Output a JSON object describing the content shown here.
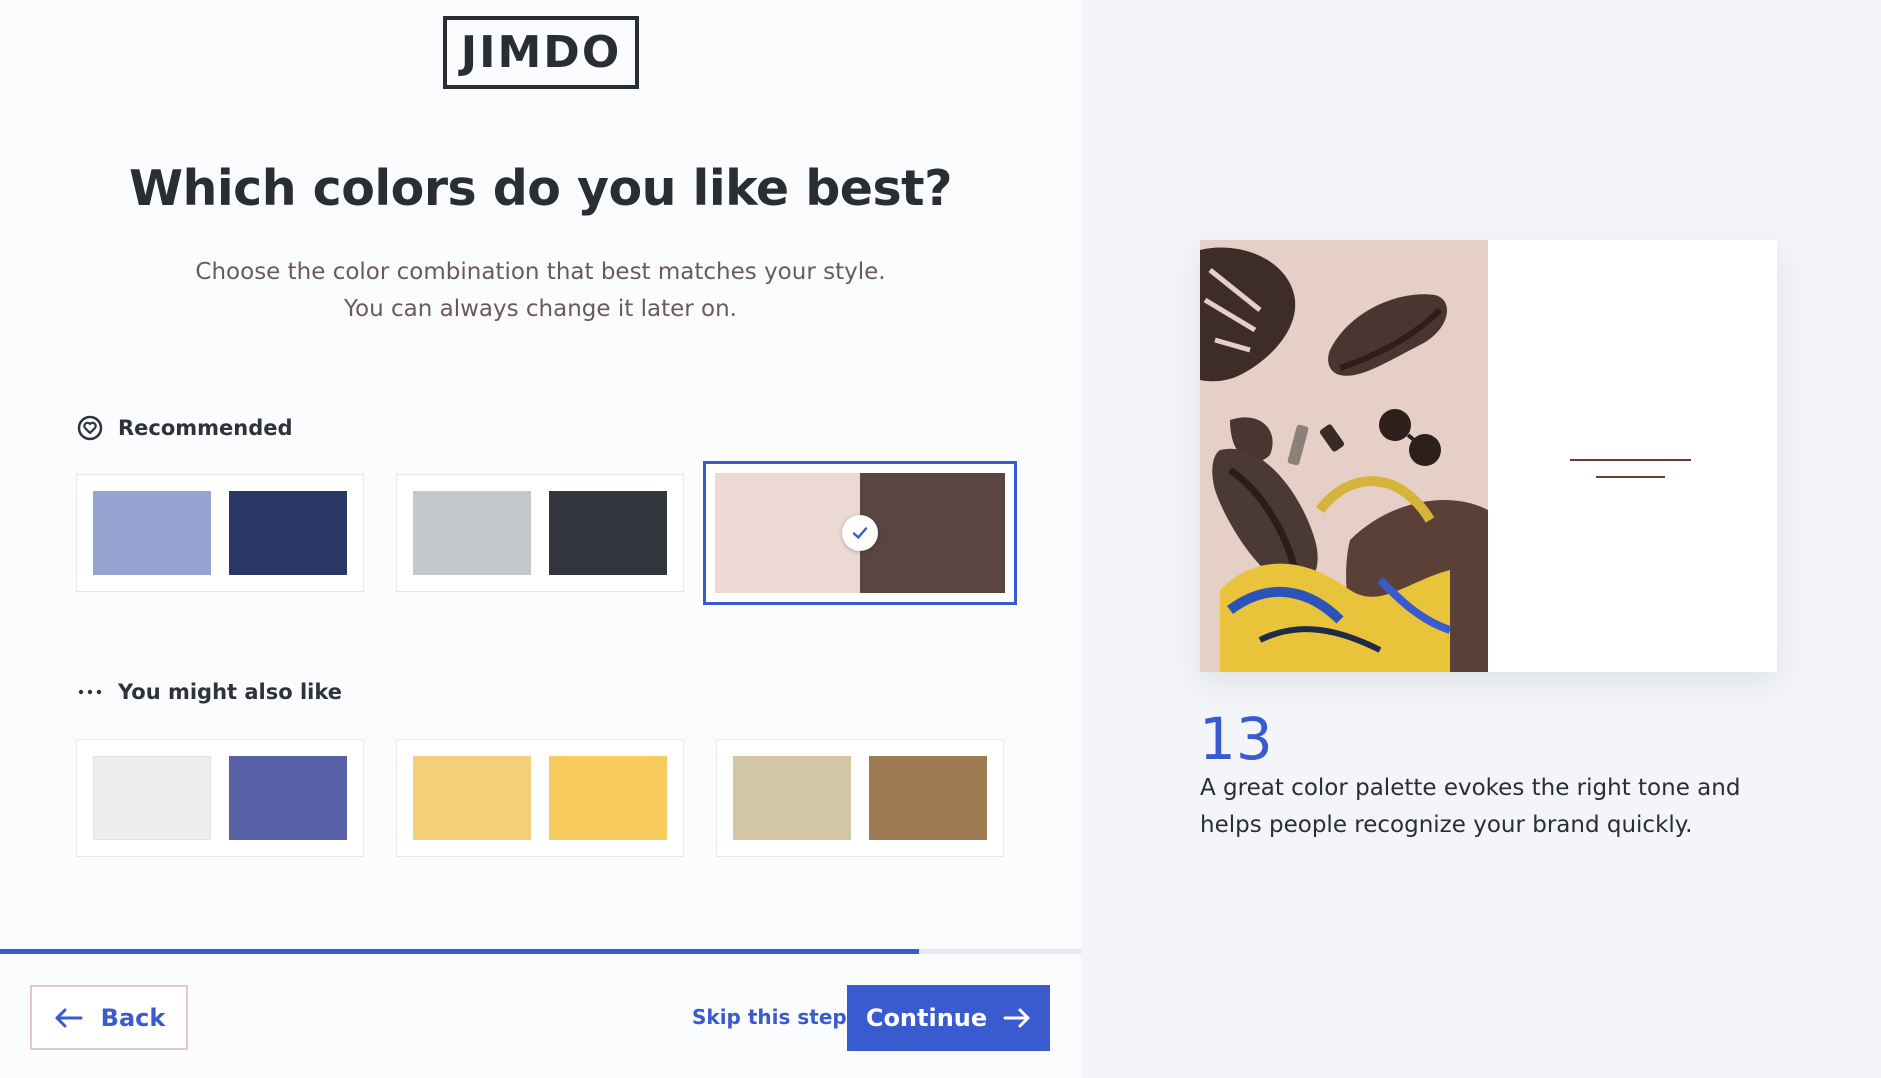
{
  "logo": {
    "text": "JIMDO"
  },
  "heading": {
    "title": "Which colors do you like best?",
    "subtitle_line1": "Choose the color combination that best matches your style.",
    "subtitle_line2": "You can always change it later on."
  },
  "recommended": {
    "label": "Recommended",
    "icon": "heart-badge-icon",
    "palettes": [
      {
        "colors": [
          "#94a3cf",
          "#283763"
        ],
        "selected": false
      },
      {
        "colors": [
          "#c3c8cc",
          "#33363c"
        ],
        "selected": false
      },
      {
        "colors": [
          "#ecd9d3",
          "#5a4541"
        ],
        "selected": true
      }
    ]
  },
  "also_like": {
    "label": "You might also like",
    "icon": "more-dots-icon",
    "palettes": [
      {
        "colors": [
          "#eeeeee",
          "#5860a6"
        ],
        "selected": false
      },
      {
        "colors": [
          "#f6cf7b",
          "#f7cb5e"
        ],
        "selected": false
      },
      {
        "colors": [
          "#d3c6a4",
          "#9e7a52"
        ],
        "selected": false
      }
    ]
  },
  "progress": {
    "value": 0.85
  },
  "footer": {
    "back_label": "Back",
    "skip_label": "Skip this step",
    "continue_label": "Continue"
  },
  "side": {
    "stat_number": "13",
    "stat_text": "A great color palette evokes the right tone and helps people recognize your brand quickly."
  },
  "colors": {
    "accent": "#3a5ad0",
    "text": "#2a2d33"
  }
}
